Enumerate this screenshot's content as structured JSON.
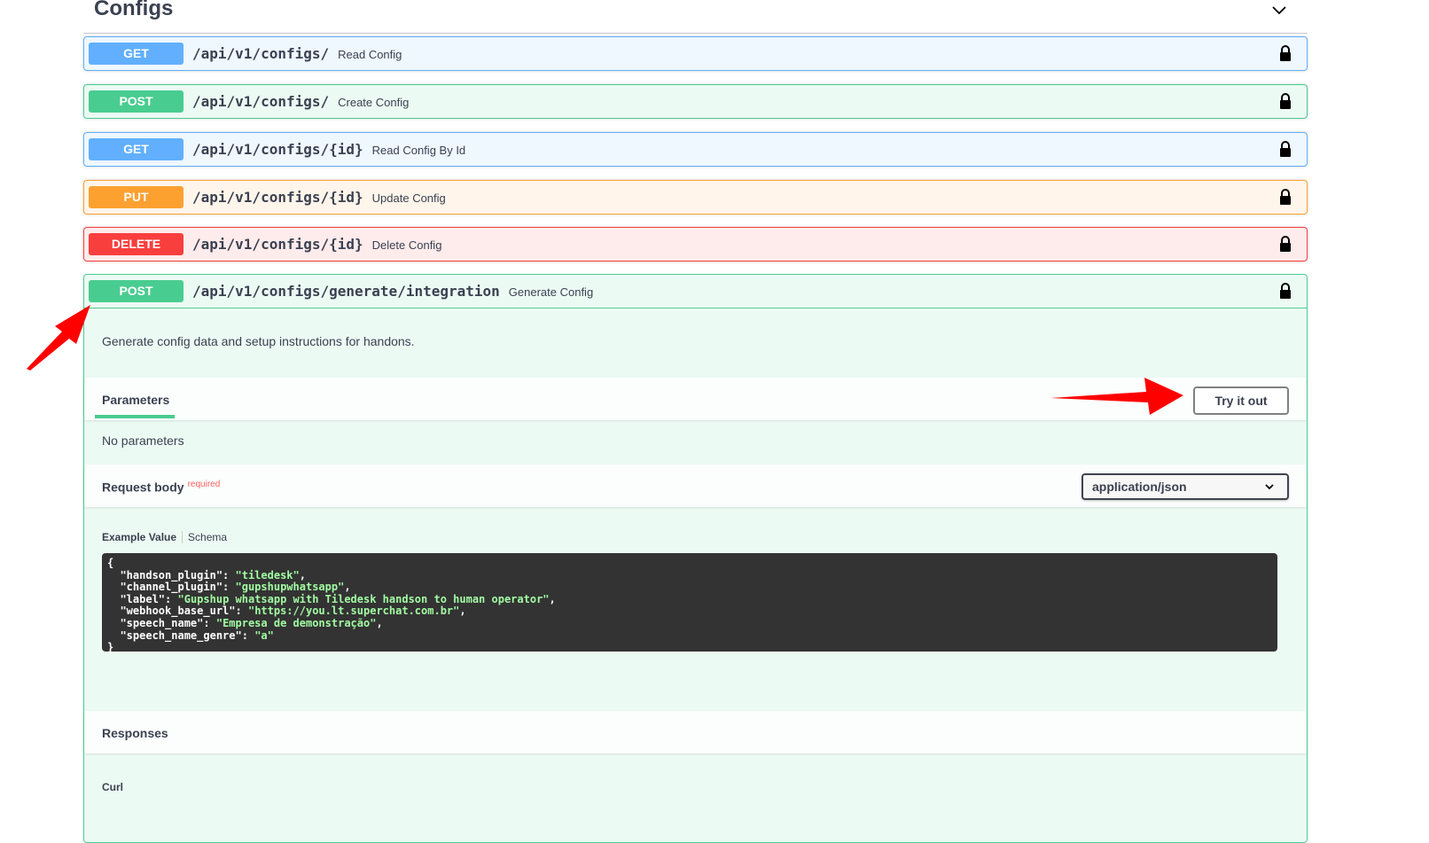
{
  "section": {
    "title": "Configs"
  },
  "endpoints": [
    {
      "method": "GET",
      "path": "/api/v1/configs/",
      "summary": "Read Config"
    },
    {
      "method": "POST",
      "path": "/api/v1/configs/",
      "summary": "Create Config"
    },
    {
      "method": "GET",
      "path": "/api/v1/configs/{id}",
      "summary": "Read Config By Id"
    },
    {
      "method": "PUT",
      "path": "/api/v1/configs/{id}",
      "summary": "Update Config"
    },
    {
      "method": "DELETE",
      "path": "/api/v1/configs/{id}",
      "summary": "Delete Config"
    }
  ],
  "expanded": {
    "method": "POST",
    "path": "/api/v1/configs/generate/integration",
    "summary": "Generate Config",
    "description": "Generate config data and setup instructions for handons.",
    "parameters_label": "Parameters",
    "try_label": "Try it out",
    "no_params": "No parameters",
    "request_body_label": "Request body",
    "required_label": "required",
    "content_type": "application/json",
    "example_tab": "Example Value",
    "schema_tab": "Schema",
    "example": {
      "handson_plugin": "tiledesk",
      "channel_plugin": "gupshupwhatsapp",
      "label": "Gupshup whatsapp with Tiledesk handson to human operator",
      "webhook_base_url": "https://you.lt.superchat.com.br",
      "speech_name": "Empresa de demonstração",
      "speech_name_genre": "a"
    },
    "responses_label": "Responses",
    "curl_label": "Curl"
  },
  "colors": {
    "get": "#61affe",
    "post": "#49cc90",
    "put": "#fca130",
    "delete": "#f93e3e",
    "arrow": "#ff0000"
  },
  "icons": {
    "lock": "lock-icon",
    "chevron": "chevron-down-icon"
  }
}
